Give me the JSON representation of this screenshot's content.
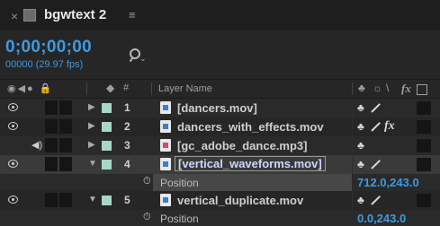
{
  "tab": {
    "close_symbol": "×",
    "title": "bgwtext 2",
    "menu_symbol": "≡",
    "swatch_color": "#6b6b6b"
  },
  "timecode": {
    "value": "0;00;00;00",
    "frames": "00000 (29.97 fps)",
    "search_placeholder": ""
  },
  "columns": {
    "switches_icons": "◉◀● 🔒",
    "label": "◆",
    "number": "#",
    "layer_name": "Layer Name",
    "shy": "♣",
    "collapse": "☼",
    "quality": "\\",
    "effects": "fx",
    "frame_blend": ""
  },
  "layers": [
    {
      "number": "1",
      "name": "[dancers.mov]",
      "video_visible": true,
      "audio": false,
      "label_color": "#a8d6c8",
      "expanded": false,
      "has_fx": false,
      "file_type": "video"
    },
    {
      "number": "2",
      "name": "dancers_with_effects.mov",
      "video_visible": true,
      "audio": false,
      "label_color": "#a8d6c8",
      "expanded": false,
      "has_fx": true,
      "file_type": "video"
    },
    {
      "number": "3",
      "name": "[gc_adobe_dance.mp3]",
      "video_visible": false,
      "audio": true,
      "label_color": "#a8d6c8",
      "expanded": false,
      "has_fx": false,
      "file_type": "audio"
    },
    {
      "number": "4",
      "name": "[vertical_waveforms.mov]",
      "video_visible": true,
      "audio": false,
      "label_color": "#a8d6c8",
      "expanded": true,
      "has_fx": false,
      "file_type": "video",
      "property": {
        "name": "Position",
        "value": "712.0,243.0"
      }
    },
    {
      "number": "5",
      "name": "vertical_duplicate.mov",
      "video_visible": true,
      "audio": false,
      "label_color": "#a8d6c8",
      "expanded": true,
      "has_fx": false,
      "file_type": "video",
      "property": {
        "name": "Position",
        "value": "0.0,243.0"
      }
    }
  ],
  "colors": {
    "accent_blue": "#3f9ae0",
    "label_aqua": "#a8d6c8"
  },
  "glyphs": {
    "collapsed": "▶",
    "expanded": "▼",
    "stopwatch": "⏱",
    "shy": "♣",
    "speaker": "◀)",
    "fx": "fx"
  }
}
